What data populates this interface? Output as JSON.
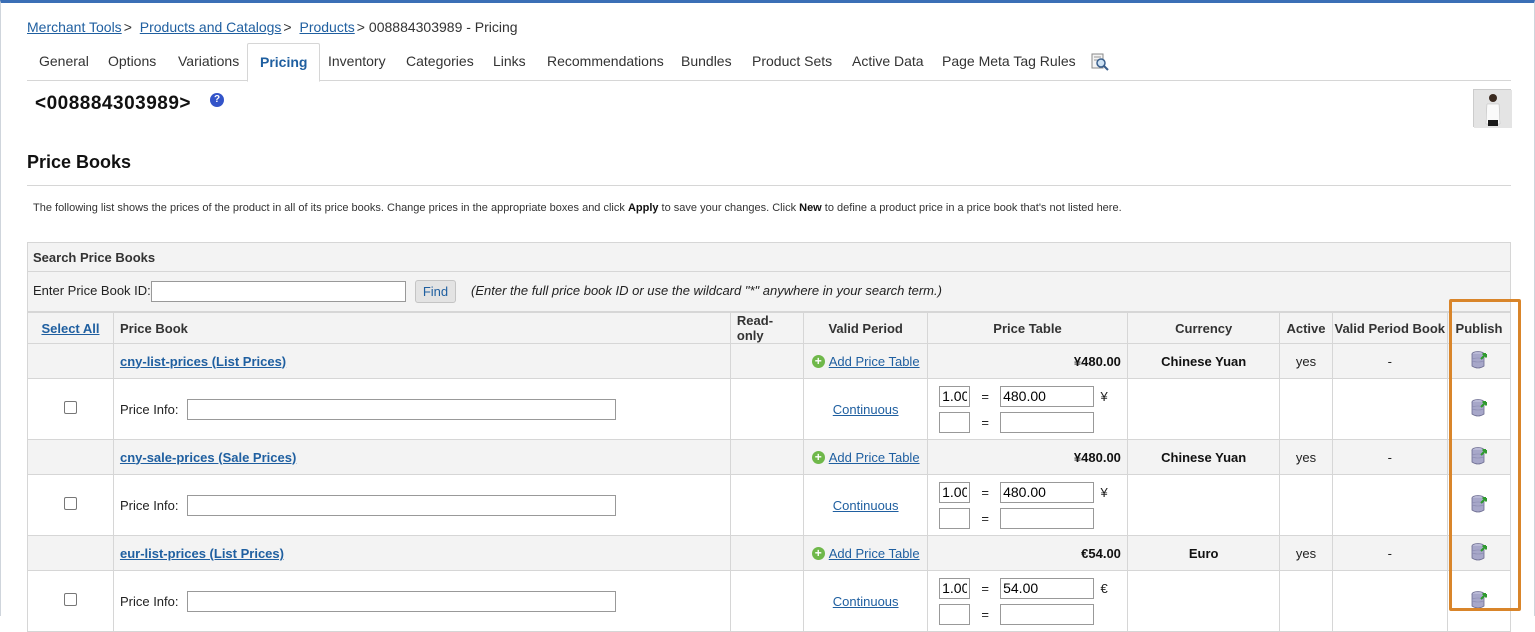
{
  "breadcrumb": {
    "items": [
      "Merchant Tools",
      "Products and Catalogs",
      "Products"
    ],
    "current": "008884303989 - Pricing",
    "separator": ">"
  },
  "tabs": [
    {
      "label": "General"
    },
    {
      "label": "Options"
    },
    {
      "label": "Variations"
    },
    {
      "label": "Pricing",
      "active": true
    },
    {
      "label": "Inventory"
    },
    {
      "label": "Categories"
    },
    {
      "label": "Links"
    },
    {
      "label": "Recommendations"
    },
    {
      "label": "Bundles"
    },
    {
      "label": "Product Sets"
    },
    {
      "label": "Active Data"
    },
    {
      "label": "Page Meta Tag Rules"
    }
  ],
  "tab_search_icon": "magnifier-page-icon",
  "product": {
    "id_display": "<008884303989>",
    "help_symbol": "?"
  },
  "section": {
    "title": "Price Books",
    "description_parts": {
      "p1": "The following list shows the prices of the product in all of its price books. Change prices in the appropriate boxes and click ",
      "apply": "Apply",
      "p2": " to save your changes. Click ",
      "new": "New",
      "p3": " to define a product price in a price book that's not listed here."
    }
  },
  "search": {
    "title": "Search Price Books",
    "label": "Enter Price Book ID:",
    "value": "",
    "button": "Find",
    "hint": "(Enter the full price book ID or use the wildcard \"*\" anywhere in your search term.)"
  },
  "table": {
    "headers": {
      "select_all": "Select All",
      "price_book": "Price Book",
      "read_only": "Read-only",
      "valid_period": "Valid Period",
      "price_table": "Price Table",
      "currency": "Currency",
      "active": "Active",
      "valid_period_book": "Valid Period Book",
      "publish": "Publish"
    },
    "add_price_table_label": "Add Price Table",
    "price_info_label": "Price Info:",
    "continuous_label": "Continuous",
    "equals": "=",
    "books": [
      {
        "name": "cny-list-prices (List Prices)",
        "price": "¥480.00",
        "currency": "Chinese Yuan",
        "active": "yes",
        "valid_period_book": "-",
        "info_value": "",
        "qty": "1.00",
        "amount": "480.00",
        "symbol": "¥",
        "qty2": "",
        "amount2": ""
      },
      {
        "name": "cny-sale-prices (Sale Prices)",
        "price": "¥480.00",
        "currency": "Chinese Yuan",
        "active": "yes",
        "valid_period_book": "-",
        "info_value": "",
        "qty": "1.00",
        "amount": "480.00",
        "symbol": "¥",
        "qty2": "",
        "amount2": ""
      },
      {
        "name": "eur-list-prices (List Prices)",
        "price": "€54.00",
        "currency": "Euro",
        "active": "yes",
        "valid_period_book": "-",
        "info_value": "",
        "qty": "1.00",
        "amount": "54.00",
        "symbol": "€",
        "qty2": "",
        "amount2": ""
      }
    ]
  },
  "colors": {
    "link": "#1f5fa0",
    "header_bg": "#f3f3f3",
    "border": "#d6d6d6",
    "highlight": "#d9852a",
    "top_bar": "#3b6fb6"
  }
}
